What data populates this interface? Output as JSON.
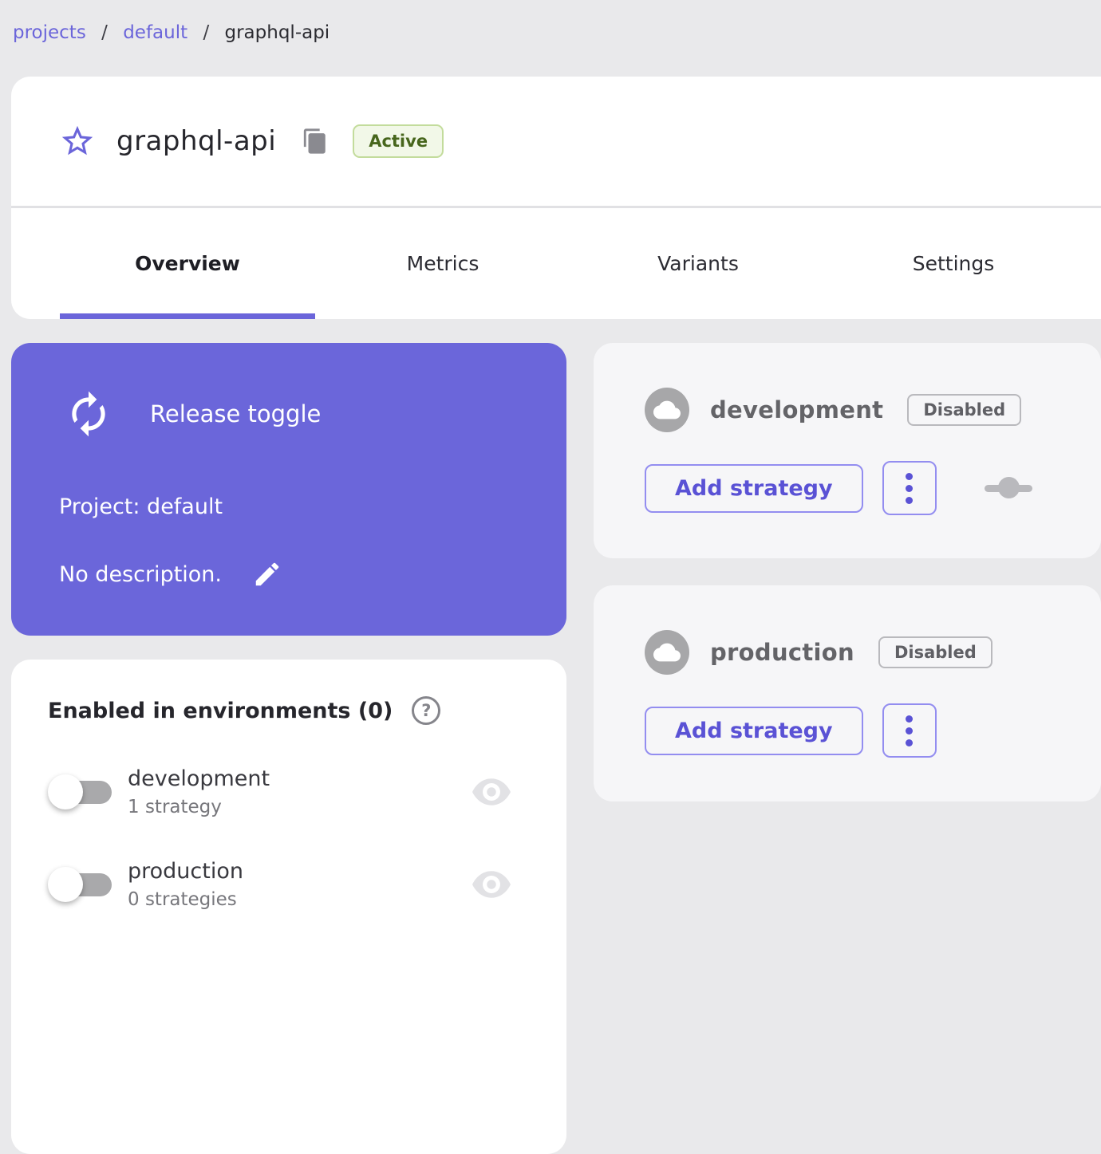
{
  "colors": {
    "accent_purple": "#6b65da",
    "page_background": "#e9e9eb",
    "active_badge_bg": "#f2f8e8",
    "active_badge_border": "#c3dc9c",
    "active_badge_text": "#47661c",
    "disabled_chip_border": "#b9b9bd"
  },
  "breadcrumb": {
    "links": [
      "projects",
      "default"
    ],
    "separator": "/",
    "current": "graphql-api"
  },
  "header": {
    "title": "graphql-api",
    "status_badge": "Active",
    "tabs": [
      {
        "label": "Overview",
        "active": true
      },
      {
        "label": "Metrics",
        "active": false
      },
      {
        "label": "Variants",
        "active": false
      },
      {
        "label": "Settings",
        "active": false
      }
    ]
  },
  "toggle_card": {
    "type_label": "Release toggle",
    "project_label": "Project: default",
    "description_label": "No description."
  },
  "enabled_card": {
    "title": "Enabled in environments (0)",
    "help_glyph": "?",
    "rows": [
      {
        "name": "development",
        "strategies": "1 strategy",
        "enabled": false
      },
      {
        "name": "production",
        "strategies": "0 strategies",
        "enabled": false
      }
    ]
  },
  "environment_cards": [
    {
      "name": "development",
      "status": "Disabled",
      "add_button": "Add strategy"
    },
    {
      "name": "production",
      "status": "Disabled",
      "add_button": "Add strategy"
    }
  ]
}
